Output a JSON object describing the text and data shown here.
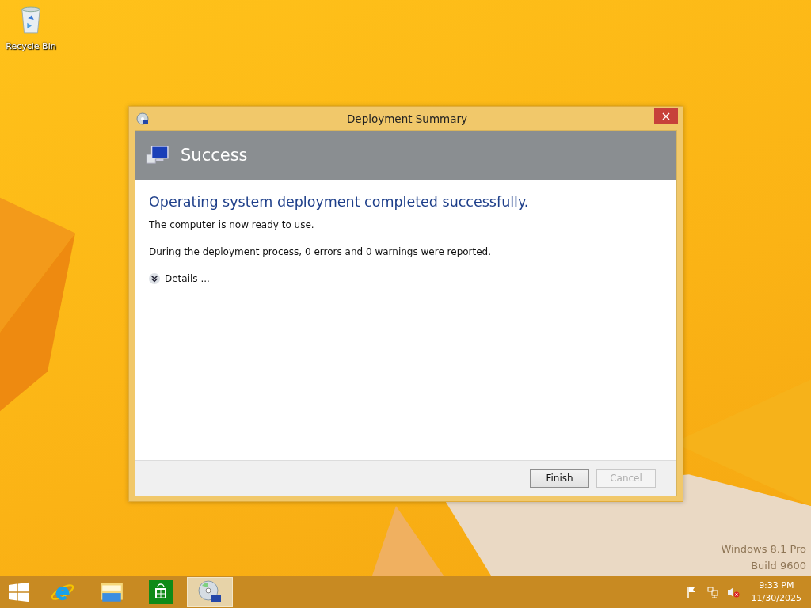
{
  "desktop": {
    "icons": [
      {
        "label": "Recycle Bin"
      }
    ],
    "watermark": {
      "edition": "Windows 8.1 Pro",
      "build": "Build 9600"
    }
  },
  "window": {
    "title": "Deployment Summary",
    "banner": "Success",
    "heading": "Operating system deployment completed successfully.",
    "paragraphs": [
      "The computer is now ready to use.",
      "During the deployment process, 0 errors and 0 warnings were reported."
    ],
    "details": {
      "label": "Details ...",
      "expanded": false
    },
    "buttons": [
      {
        "label": "Finish",
        "disabled": false
      },
      {
        "label": "Cancel",
        "disabled": true
      }
    ]
  },
  "taskbar": {
    "apps": [
      {
        "kind": "ie",
        "selected": false
      },
      {
        "kind": "explorer",
        "selected": false
      },
      {
        "kind": "store",
        "selected": false
      },
      {
        "kind": "disc",
        "selected": true
      }
    ],
    "clock": {
      "time": "9:33 PM",
      "date": "11/30/2025"
    }
  }
}
